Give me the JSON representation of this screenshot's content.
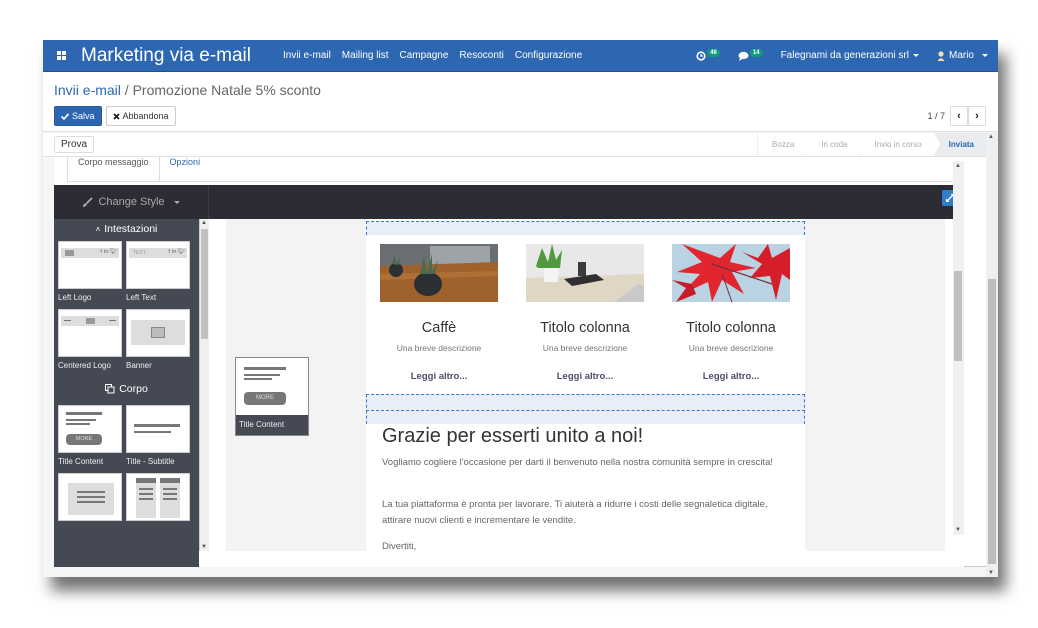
{
  "navbar": {
    "app_title": "Marketing via e-mail",
    "menu": [
      "Invii e-mail",
      "Mailing list",
      "Campagne",
      "Resoconti",
      "Configurazione"
    ],
    "activity_count": "46",
    "message_count": "14",
    "company": "Falegnami da generazioni srl",
    "user": "Mario",
    "brand_color": "#2e67b1"
  },
  "control_panel": {
    "breadcrumb_parent": "Invii e-mail",
    "breadcrumb_separator": "/",
    "breadcrumb_current": "Promozione Natale 5% sconto",
    "save_label": "Salva",
    "discard_label": "Abbandona",
    "pager_value": "1 / 7"
  },
  "sheet_header": {
    "test_button": "Prova",
    "status_steps": [
      {
        "label": "Bozza",
        "active": false
      },
      {
        "label": "In coda",
        "active": false
      },
      {
        "label": "Invio in corso",
        "active": false
      },
      {
        "label": "Inviata",
        "active": true
      }
    ]
  },
  "tabs": [
    {
      "label": "Corpo messaggio",
      "active": true
    },
    {
      "label": "Opzioni",
      "active": false
    }
  ],
  "editor": {
    "change_style_label": "Change Style",
    "sections": [
      {
        "title": "Intestazioni",
        "snippets": [
          "Left Logo",
          "Left Text",
          "Centered Logo",
          "Banner"
        ]
      },
      {
        "title": "Corpo",
        "snippets": [
          "Title Content",
          "Title - Subtitle"
        ]
      }
    ],
    "thumb_text": {
      "more": "MORE",
      "text": "TEXT",
      "social": "f in"
    },
    "dragging_snippet": "Title Content"
  },
  "mail": {
    "columns": [
      {
        "title": "Caffè",
        "description": "Una breve descrizione",
        "link": "Leggi altro..."
      },
      {
        "title": "Titolo colonna",
        "description": "Una breve descrizione",
        "link": "Leggi altro..."
      },
      {
        "title": "Titolo colonna",
        "description": "Una breve descrizione",
        "link": "Leggi altro..."
      }
    ],
    "heading": "Grazie per esserti unito a noi!",
    "paragraph1": "Vogliamo cogliere l'occasione per darti il benvenuto nella nostra comunità sempre in crescita!",
    "paragraph2": "La tua piattaforma è pronta per lavorare. Ti aiuterà a ridurre i costi delle segnaletica digitale, attirare nuovi clienti e incrementare le vendite.",
    "paragraph3": "Divertiti,"
  }
}
